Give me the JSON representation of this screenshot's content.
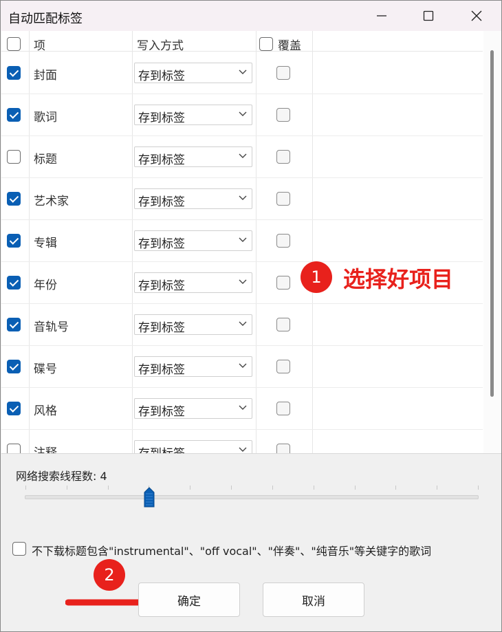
{
  "window": {
    "title": "自动匹配标签"
  },
  "header": {
    "item": "项",
    "mode": "写入方式",
    "overwrite": "覆盖"
  },
  "rows": [
    {
      "label": "封面",
      "checked": true,
      "mode": "存到标签",
      "overwrite": false
    },
    {
      "label": "歌词",
      "checked": true,
      "mode": "存到标签",
      "overwrite": false
    },
    {
      "label": "标题",
      "checked": false,
      "mode": "存到标签",
      "overwrite": false
    },
    {
      "label": "艺术家",
      "checked": true,
      "mode": "存到标签",
      "overwrite": false
    },
    {
      "label": "专辑",
      "checked": true,
      "mode": "存到标签",
      "overwrite": false
    },
    {
      "label": "年份",
      "checked": true,
      "mode": "存到标签",
      "overwrite": false
    },
    {
      "label": "音轨号",
      "checked": true,
      "mode": "存到标签",
      "overwrite": false
    },
    {
      "label": "碟号",
      "checked": true,
      "mode": "存到标签",
      "overwrite": false
    },
    {
      "label": "风格",
      "checked": true,
      "mode": "存到标签",
      "overwrite": false
    },
    {
      "label": "注释",
      "checked": false,
      "mode": "存到标签",
      "overwrite": false
    }
  ],
  "threads": {
    "label": "网络搜索线程数: 4",
    "value": 4,
    "min": 1,
    "max": 12
  },
  "option": {
    "label": "不下载标题包含\"instrumental\"、\"off vocal\"、\"伴奏\"、\"纯音乐\"等关键字的歌词",
    "checked": false
  },
  "buttons": {
    "ok": "确定",
    "cancel": "取消"
  },
  "annotations": {
    "step1_number": "1",
    "step1_text": "选择好项目",
    "step2_number": "2"
  },
  "colors": {
    "accent": "#0a5fb4",
    "annotation": "#e8211c"
  }
}
